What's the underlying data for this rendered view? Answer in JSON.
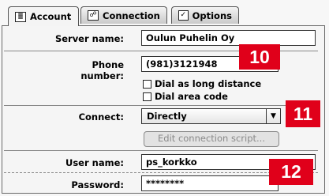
{
  "tabs": [
    {
      "label": "Account",
      "icon": "account-list-icon"
    },
    {
      "label": "Connection",
      "icon": "connection-icon"
    },
    {
      "label": "Options",
      "icon": "options-checkbox-icon"
    }
  ],
  "form": {
    "server_name_label": "Server name:",
    "server_name_value": "Oulun Puhelin Oy",
    "phone_label": "Phone number:",
    "phone_value": "(981)3121948",
    "dial_long_label": "Dial as long distance",
    "dial_area_label": "Dial area code",
    "connect_label": "Connect:",
    "connect_value": "Directly",
    "edit_script_label": "Edit connection script...",
    "user_label": "User name:",
    "user_value": "ps_korkko",
    "password_label": "Password:",
    "password_value": "********"
  },
  "badges": [
    "10",
    "11",
    "12"
  ],
  "colors": {
    "badge": "#e0001a"
  }
}
